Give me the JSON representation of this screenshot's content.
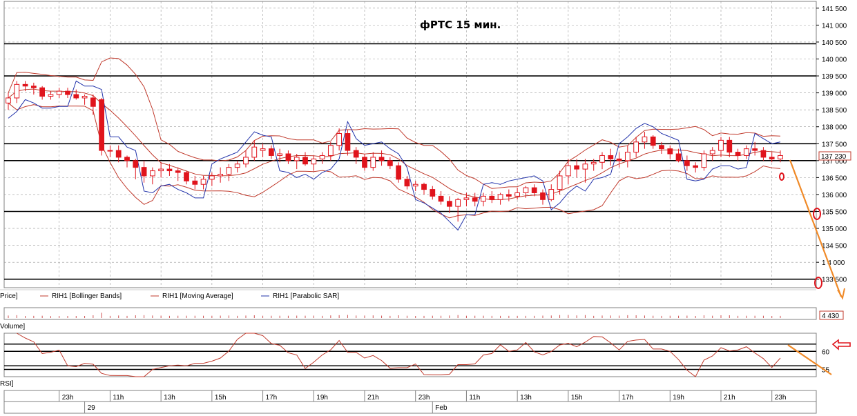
{
  "chart_data": {
    "type": "candlestick",
    "title": "фРТС   15 мин.",
    "colors": {
      "candle": "#e0141c",
      "bollinger": "#c0392b",
      "ma": "#c0392b",
      "sar": "#2233aa",
      "rsi": "#c0392b",
      "volume": "#d05050",
      "levels": "#000000",
      "annot": "#f08a28",
      "grid": "#9a9a9a"
    },
    "price_axis": {
      "ylim": [
        133250,
        141700
      ],
      "ticks": [
        "141 500",
        "141 000",
        "140 500",
        "140 000",
        "139 500",
        "139 000",
        "138 500",
        "138 000",
        "137 500",
        "137 000",
        "136 500",
        "136 000",
        "135 500",
        "135 000",
        "134 500",
        "1 4 000",
        "133 500"
      ],
      "tick_values": [
        141500,
        141000,
        140500,
        140000,
        139500,
        139000,
        138500,
        138000,
        137500,
        137000,
        136500,
        136000,
        135500,
        135000,
        134500,
        134000,
        133500
      ],
      "last_price_label": "137 230"
    },
    "time_axis": {
      "labels": [
        "23h",
        "11h",
        "13h",
        "15h",
        "17h",
        "19h",
        "21h",
        "23h",
        "11h",
        "13h",
        "15h",
        "17h",
        "19h",
        "21h",
        "23h"
      ],
      "label_bars": [
        6,
        12,
        18,
        24,
        30,
        36,
        42,
        48,
        54,
        60,
        66,
        72,
        78,
        84,
        90
      ],
      "date_labels": [
        "29",
        "Feb"
      ],
      "date_bars": [
        9,
        50
      ]
    },
    "horizontal_levels": [
      140450,
      139500,
      137500,
      137000,
      135500,
      133500
    ],
    "candles": [
      [
        138700,
        139000,
        138500,
        138850
      ],
      [
        138850,
        139350,
        138700,
        139250
      ],
      [
        139250,
        139350,
        139050,
        139200
      ],
      [
        139200,
        139300,
        138950,
        139150
      ],
      [
        139150,
        139200,
        138800,
        138900
      ],
      [
        138900,
        139050,
        138800,
        138950
      ],
      [
        138950,
        139150,
        138850,
        139050
      ],
      [
        139050,
        139150,
        138850,
        138950
      ],
      [
        138950,
        139100,
        138800,
        138850
      ],
      [
        138850,
        138950,
        138650,
        138900
      ],
      [
        138850,
        138950,
        138350,
        138600
      ],
      [
        138800,
        138850,
        137150,
        137300
      ],
      [
        137300,
        137450,
        137100,
        137300
      ],
      [
        137300,
        137450,
        136950,
        137100
      ],
      [
        137100,
        137150,
        136800,
        137000
      ],
      [
        137000,
        137050,
        136450,
        136800
      ],
      [
        136800,
        137000,
        136350,
        136550
      ],
      [
        136550,
        136800,
        136300,
        136700
      ],
      [
        136700,
        136950,
        136500,
        136750
      ],
      [
        136750,
        136900,
        136550,
        136700
      ],
      [
        136700,
        136800,
        136400,
        136650
      ],
      [
        136650,
        136700,
        136300,
        136400
      ],
      [
        136400,
        136550,
        136150,
        136300
      ],
      [
        136300,
        136550,
        136150,
        136450
      ],
      [
        136450,
        136650,
        136250,
        136550
      ],
      [
        136550,
        136800,
        136350,
        136600
      ],
      [
        136600,
        136900,
        136400,
        136800
      ],
      [
        136800,
        137000,
        136650,
        136900
      ],
      [
        136900,
        137300,
        136800,
        137100
      ],
      [
        137100,
        137600,
        137000,
        137400
      ],
      [
        137300,
        137500,
        137100,
        137350
      ],
      [
        137350,
        137450,
        137050,
        137150
      ],
      [
        137150,
        137350,
        136950,
        137200
      ],
      [
        137200,
        137300,
        136900,
        137000
      ],
      [
        137000,
        137200,
        136750,
        137100
      ],
      [
        137100,
        137250,
        136850,
        136900
      ],
      [
        136900,
        137150,
        136700,
        137050
      ],
      [
        137050,
        137250,
        136900,
        137150
      ],
      [
        137150,
        137550,
        137000,
        137450
      ],
      [
        137450,
        137950,
        137300,
        137800
      ],
      [
        137800,
        137900,
        137150,
        137300
      ],
      [
        137300,
        137400,
        136900,
        137100
      ],
      [
        137100,
        137200,
        136700,
        136800
      ],
      [
        136800,
        137250,
        136700,
        137100
      ],
      [
        137100,
        137300,
        136850,
        137000
      ],
      [
        137000,
        137100,
        136750,
        136850
      ],
      [
        136850,
        136950,
        136350,
        136450
      ],
      [
        136450,
        136550,
        136150,
        136250
      ],
      [
        136250,
        136400,
        136100,
        136300
      ],
      [
        136300,
        136350,
        136000,
        136150
      ],
      [
        136150,
        136250,
        135850,
        135950
      ],
      [
        135950,
        136100,
        135700,
        135800
      ],
      [
        135800,
        135950,
        135450,
        135650
      ],
      [
        135650,
        135900,
        135200,
        135850
      ],
      [
        135850,
        136050,
        135650,
        135900
      ],
      [
        135900,
        136050,
        135650,
        135800
      ],
      [
        135800,
        136050,
        135650,
        135950
      ],
      [
        135950,
        136100,
        135750,
        135850
      ],
      [
        135850,
        136050,
        135700,
        136000
      ],
      [
        136000,
        136150,
        135800,
        135950
      ],
      [
        135950,
        136200,
        135850,
        136050
      ],
      [
        136050,
        136250,
        135900,
        136200
      ],
      [
        136200,
        136300,
        135950,
        136050
      ],
      [
        136050,
        136150,
        135700,
        135850
      ],
      [
        135850,
        136300,
        135800,
        136150
      ],
      [
        136150,
        136700,
        136000,
        136550
      ],
      [
        136550,
        137050,
        136300,
        136850
      ],
      [
        136850,
        137050,
        136500,
        136750
      ],
      [
        136750,
        137050,
        136350,
        136900
      ],
      [
        136900,
        137050,
        136700,
        136950
      ],
      [
        136950,
        137250,
        136750,
        137150
      ],
      [
        137150,
        137350,
        136850,
        137050
      ],
      [
        137050,
        137250,
        136800,
        137000
      ],
      [
        137000,
        137450,
        136800,
        137250
      ],
      [
        137250,
        137700,
        137100,
        137550
      ],
      [
        137550,
        137850,
        137350,
        137700
      ],
      [
        137700,
        137750,
        137350,
        137450
      ],
      [
        137450,
        137550,
        137200,
        137350
      ],
      [
        137350,
        137450,
        137050,
        137200
      ],
      [
        137200,
        137350,
        136950,
        137000
      ],
      [
        137000,
        137150,
        136700,
        136850
      ],
      [
        136850,
        136950,
        136650,
        136800
      ],
      [
        136800,
        137300,
        136700,
        137200
      ],
      [
        137200,
        137400,
        137000,
        137300
      ],
      [
        137300,
        137700,
        137100,
        137600
      ],
      [
        137600,
        137700,
        137100,
        137250
      ],
      [
        137250,
        137350,
        137000,
        137150
      ],
      [
        137150,
        137450,
        137050,
        137350
      ],
      [
        137350,
        137550,
        137150,
        137300
      ],
      [
        137300,
        137400,
        137000,
        137100
      ],
      [
        137100,
        137250,
        136950,
        137050
      ],
      [
        137050,
        137300,
        136950,
        137150
      ]
    ],
    "volume_label": "4 430",
    "rsi": {
      "ylim": [
        53,
        65
      ],
      "levels": [
        62,
        60,
        56,
        55
      ],
      "tick_labels": [
        "60",
        "55"
      ],
      "tick_values": [
        60,
        55
      ]
    },
    "legend": [
      {
        "name": "RIH1 [Bollinger Bands]",
        "color": "#c0392b"
      },
      {
        "name": "RIH1 [Moving Average]",
        "color": "#c0392b"
      },
      {
        "name": "RIH1 [Parabolic SAR]",
        "color": "#2233aa"
      }
    ]
  },
  "panels": {
    "price_label": "Price]",
    "volume_label": "Volume]",
    "rsi_label": "RSI]"
  }
}
